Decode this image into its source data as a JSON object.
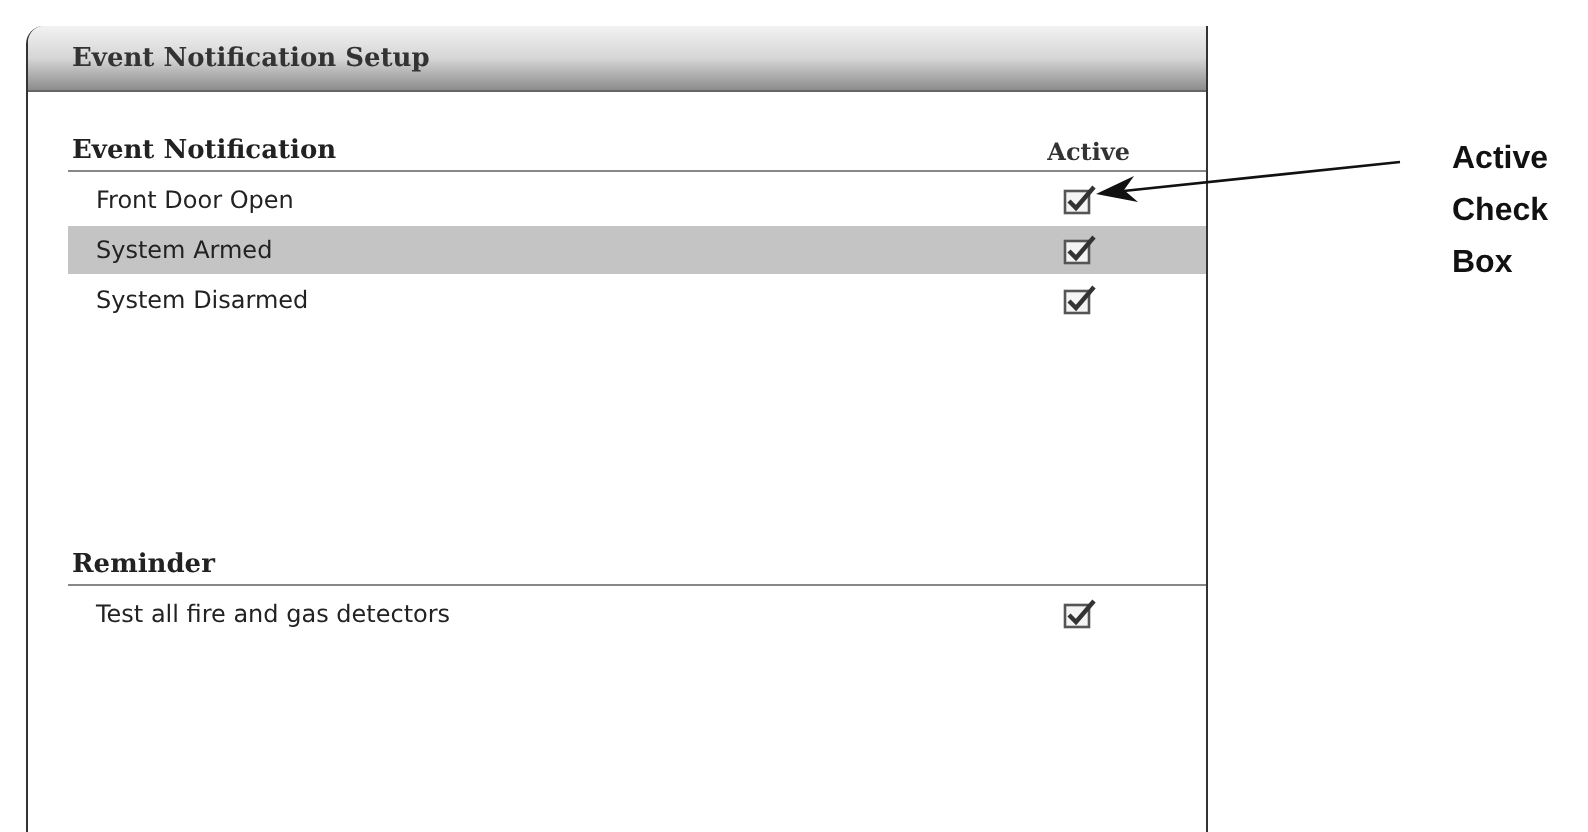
{
  "window": {
    "title": "Event Notification Setup"
  },
  "sections": [
    {
      "heading": "Event Notification",
      "column_label": "Active",
      "rows": [
        {
          "label": "Front Door Open",
          "checked": true,
          "selected": false
        },
        {
          "label": "System Armed",
          "checked": true,
          "selected": true
        },
        {
          "label": "System Disarmed",
          "checked": true,
          "selected": false
        }
      ]
    },
    {
      "heading": "Reminder",
      "rows": [
        {
          "label": "Test all fire and gas detectors",
          "checked": true,
          "selected": false
        }
      ]
    }
  ],
  "callout": {
    "text": "Active Check Box"
  }
}
